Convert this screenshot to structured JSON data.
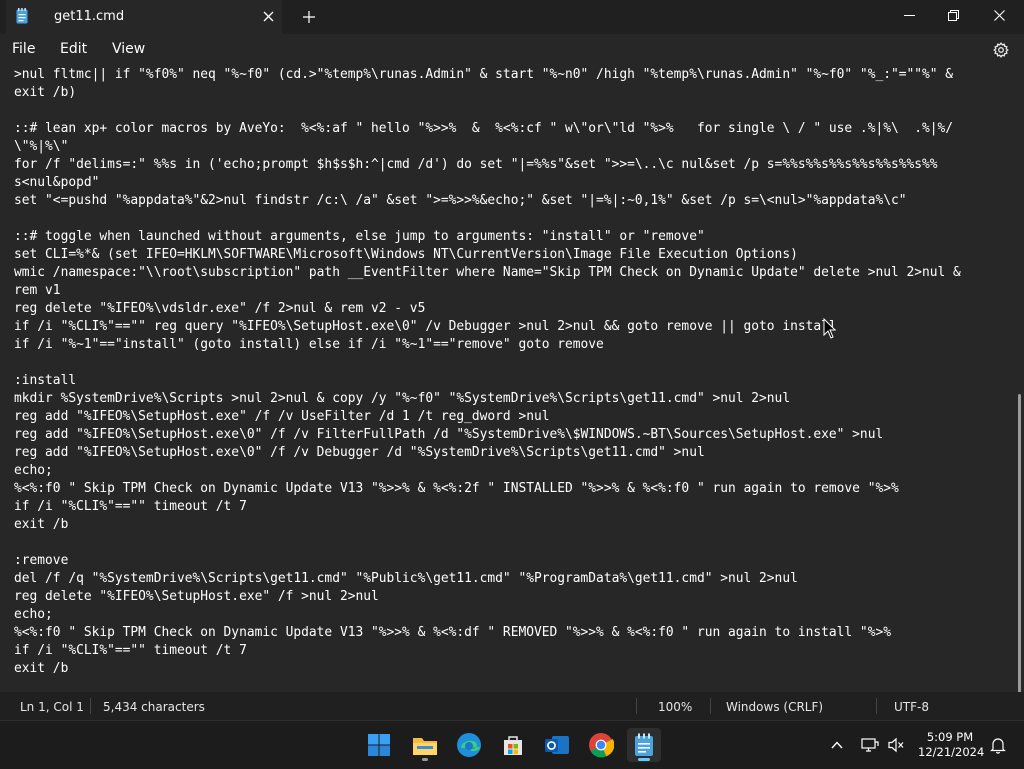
{
  "window": {
    "tab_title": "get11.cmd",
    "icons": {
      "app": "notepad-icon",
      "close_tab": "close-icon",
      "new_tab": "plus-icon",
      "minimize": "minimize-icon",
      "maximize": "maximize-icon",
      "close": "close-icon"
    }
  },
  "menu": {
    "items": [
      "File",
      "Edit",
      "View"
    ],
    "settings_icon": "gear-icon"
  },
  "editor": {
    "lines": [
      ">nul fltmc|| if \"%f0%\" neq \"%~f0\" (cd.>\"%temp%\\runas.Admin\" & start \"%~n0\" /high \"%temp%\\runas.Admin\" \"%~f0\" \"%_:\"=\"\"%\" &",
      "exit /b)",
      "",
      "::# lean xp+ color macros by AveYo:  %<%:af \" hello \"%>>%  &  %<%:cf \" w\\\"or\\\"ld \"%>%   for single \\ / \" use .%|%\\  .%|%/",
      "\\\"%|%\\\"",
      "for /f \"delims=:\" %%s in ('echo;prompt $h$s$h:^|cmd /d') do set \"|=%%s\"&set \">>=\\..\\c nul&set /p s=%%s%%s%%s%%s%%s%%s%%",
      "s<nul&popd\"",
      "set \"<=pushd \"%appdata%\"&2>nul findstr /c:\\ /a\" &set \">=%>>%&echo;\" &set \"|=%|:~0,1%\" &set /p s=\\<nul>\"%appdata%\\c\"",
      "",
      "::# toggle when launched without arguments, else jump to arguments: \"install\" or \"remove\"",
      "set CLI=%*& (set IFEO=HKLM\\SOFTWARE\\Microsoft\\Windows NT\\CurrentVersion\\Image File Execution Options)",
      "wmic /namespace:\"\\\\root\\subscription\" path __EventFilter where Name=\"Skip TPM Check on Dynamic Update\" delete >nul 2>nul &",
      "rem v1",
      "reg delete \"%IFEO%\\vdsldr.exe\" /f 2>nul & rem v2 - v5",
      "if /i \"%CLI%\"==\"\" reg query \"%IFEO%\\SetupHost.exe\\0\" /v Debugger >nul 2>nul && goto remove || goto install",
      "if /i \"%~1\"==\"install\" (goto install) else if /i \"%~1\"==\"remove\" goto remove",
      "",
      ":install",
      "mkdir %SystemDrive%\\Scripts >nul 2>nul & copy /y \"%~f0\" \"%SystemDrive%\\Scripts\\get11.cmd\" >nul 2>nul",
      "reg add \"%IFEO%\\SetupHost.exe\" /f /v UseFilter /d 1 /t reg_dword >nul",
      "reg add \"%IFEO%\\SetupHost.exe\\0\" /f /v FilterFullPath /d \"%SystemDrive%\\$WINDOWS.~BT\\Sources\\SetupHost.exe\" >nul",
      "reg add \"%IFEO%\\SetupHost.exe\\0\" /f /v Debugger /d \"%SystemDrive%\\Scripts\\get11.cmd\" >nul",
      "echo;",
      "%<%:f0 \" Skip TPM Check on Dynamic Update V13 \"%>>% & %<%:2f \" INSTALLED \"%>>% & %<%:f0 \" run again to remove \"%>%",
      "if /i \"%CLI%\"==\"\" timeout /t 7",
      "exit /b",
      "",
      ":remove",
      "del /f /q \"%SystemDrive%\\Scripts\\get11.cmd\" \"%Public%\\get11.cmd\" \"%ProgramData%\\get11.cmd\" >nul 2>nul",
      "reg delete \"%IFEO%\\SetupHost.exe\" /f >nul 2>nul",
      "echo;",
      "%<%:f0 \" Skip TPM Check on Dynamic Update V13 \"%>>% & %<%:df \" REMOVED \"%>>% & %<%:f0 \" run again to install \"%>%",
      "if /i \"%CLI%\"==\"\" timeout /t 7",
      "exit /b"
    ]
  },
  "status": {
    "position": "Ln 1, Col 1",
    "characters": "5,434 characters",
    "zoom": "100%",
    "line_endings": "Windows (CRLF)",
    "encoding": "UTF-8"
  },
  "taskbar": {
    "icons": [
      "windows-start-icon",
      "file-explorer-icon",
      "edge-icon",
      "store-icon",
      "outlook-icon",
      "chrome-icon",
      "notepad-icon"
    ],
    "tray_icons": [
      "chevron-up-icon",
      "network-icon",
      "volume-icon",
      "notification-icon"
    ],
    "time": "5:09 PM",
    "date": "12/21/2024"
  },
  "colors": {
    "background": "#272727",
    "chrome": "#202020",
    "accent": "#60cdff"
  }
}
